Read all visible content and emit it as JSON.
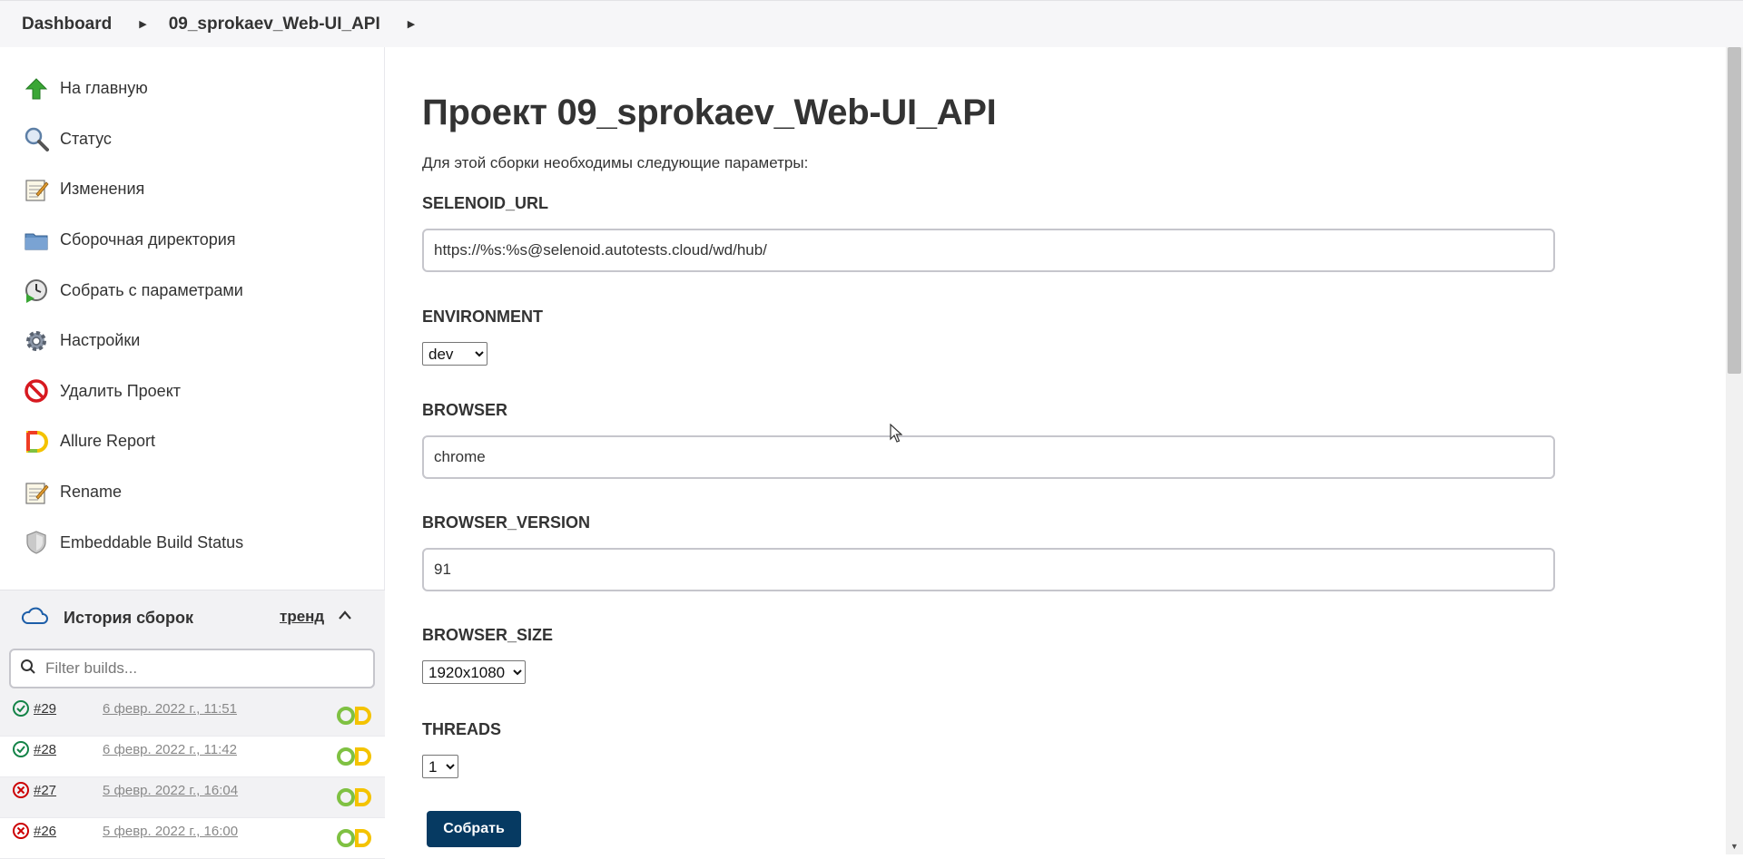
{
  "breadcrumb": {
    "items": [
      "Dashboard",
      "09_sprokaev_Web-UI_API"
    ]
  },
  "sidebar": {
    "tasks": [
      {
        "label": "На главную",
        "icon": "up-arrow-icon"
      },
      {
        "label": "Статус",
        "icon": "magnifier-icon"
      },
      {
        "label": "Изменения",
        "icon": "notepad-icon"
      },
      {
        "label": "Сборочная директория",
        "icon": "folder-icon"
      },
      {
        "label": "Собрать с параметрами",
        "icon": "clock-play-icon"
      },
      {
        "label": "Настройки",
        "icon": "gear-icon"
      },
      {
        "label": "Удалить Проект",
        "icon": "no-entry-icon"
      },
      {
        "label": "Allure Report",
        "icon": "allure-icon"
      },
      {
        "label": "Rename",
        "icon": "notepad-icon"
      },
      {
        "label": "Embeddable Build Status",
        "icon": "shield-icon"
      }
    ]
  },
  "history": {
    "title": "История сборок",
    "trend_label": "тренд",
    "filter_placeholder": "Filter builds...",
    "builds": [
      {
        "number": "#29",
        "date": "6 февр. 2022 г., 11:51",
        "status": "success"
      },
      {
        "number": "#28",
        "date": "6 февр. 2022 г., 11:42",
        "status": "success"
      },
      {
        "number": "#27",
        "date": "5 февр. 2022 г., 16:04",
        "status": "failed"
      },
      {
        "number": "#26",
        "date": "5 февр. 2022 г., 16:00",
        "status": "failed"
      }
    ]
  },
  "main": {
    "title": "Проект 09_sprokaev_Web-UI_API",
    "intro": "Для этой сборки необходимы следующие параметры:",
    "params": {
      "selenoid_url": {
        "label": "SELENOID_URL",
        "value": "https://%s:%s@selenoid.autotests.cloud/wd/hub/"
      },
      "environment": {
        "label": "ENVIRONMENT",
        "value": "dev"
      },
      "browser": {
        "label": "BROWSER",
        "value": "chrome"
      },
      "browser_version": {
        "label": "BROWSER_VERSION",
        "value": "91"
      },
      "browser_size": {
        "label": "BROWSER_SIZE",
        "value": "1920x1080"
      },
      "threads": {
        "label": "THREADS",
        "value": "1"
      }
    },
    "build_button": "Собрать"
  },
  "colors": {
    "primary_button": "#063a62",
    "success": "#138347",
    "failed": "#cc0003",
    "breadcrumb_bg": "#f6f6f8"
  }
}
